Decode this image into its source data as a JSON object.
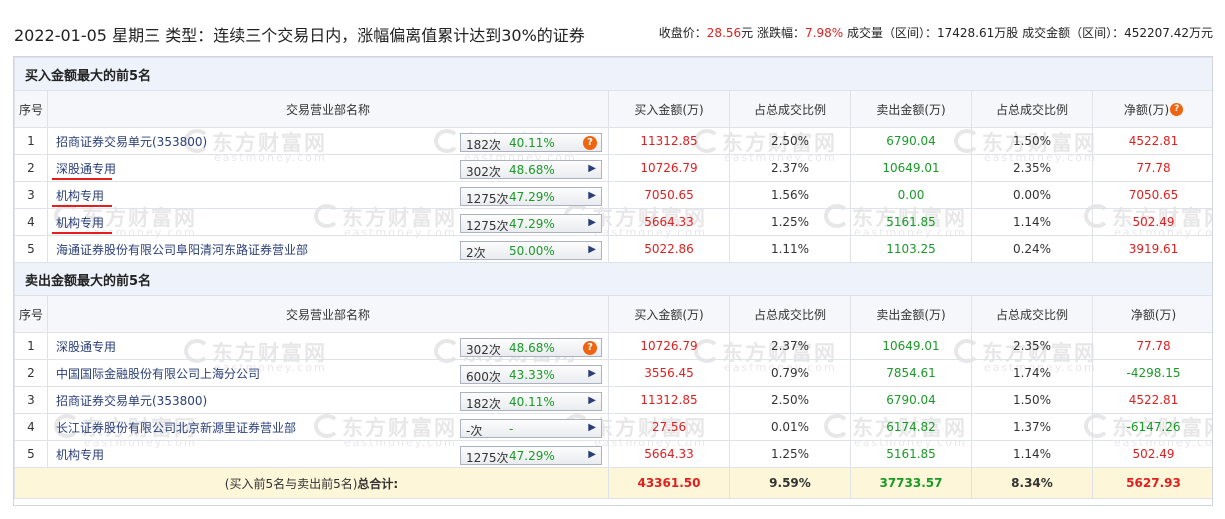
{
  "header": {
    "date": "2022-01-05",
    "weekday": "星期三",
    "type_label": "类型：",
    "type_text": "连续三个交易日内，涨幅偏离值累计达到30%的证券",
    "close_label": "收盘价：",
    "close_value": "28.56",
    "close_unit": "元",
    "change_label": "涨跌幅：",
    "change_value": "7.98%",
    "volume_label": "成交量（区间）：",
    "volume_value": "17428.61万股",
    "amount_label": "成交金额（区间）：",
    "amount_value": "452207.42万元"
  },
  "columns": {
    "seq": "序号",
    "name": "交易营业部名称",
    "buy": "买入金额(万)",
    "buy_ratio": "占总成交比例",
    "sell": "卖出金额(万)",
    "sell_ratio": "占总成交比例",
    "net": "净额(万)"
  },
  "watermark": {
    "cn": "东方财富网",
    "en": "eastmoney.com"
  },
  "buy_section": {
    "title": "买入金额最大的前5名",
    "rows": [
      {
        "seq": "1",
        "name": "招商证券交易单元(353800)",
        "count": "182次",
        "pct": "40.11%",
        "buy": "11312.85",
        "buy_ratio": "2.50%",
        "sell": "6790.04",
        "sell_ratio": "1.50%",
        "net": "4522.81"
      },
      {
        "seq": "2",
        "name": "深股通专用",
        "count": "302次",
        "pct": "48.68%",
        "buy": "10726.79",
        "buy_ratio": "2.37%",
        "sell": "10649.01",
        "sell_ratio": "2.35%",
        "net": "77.78"
      },
      {
        "seq": "3",
        "name": "机构专用",
        "count": "1275次",
        "pct": "47.29%",
        "buy": "7050.65",
        "buy_ratio": "1.56%",
        "sell": "0.00",
        "sell_ratio": "0.00%",
        "net": "7050.65"
      },
      {
        "seq": "4",
        "name": "机构专用",
        "count": "1275次",
        "pct": "47.29%",
        "buy": "5664.33",
        "buy_ratio": "1.25%",
        "sell": "5161.85",
        "sell_ratio": "1.14%",
        "net": "502.49"
      },
      {
        "seq": "5",
        "name": "海通证券股份有限公司阜阳清河东路证券营业部",
        "count": "2次",
        "pct": "50.00%",
        "buy": "5022.86",
        "buy_ratio": "1.11%",
        "sell": "1103.25",
        "sell_ratio": "0.24%",
        "net": "3919.61"
      }
    ]
  },
  "sell_section": {
    "title": "卖出金额最大的前5名",
    "rows": [
      {
        "seq": "1",
        "name": "深股通专用",
        "count": "302次",
        "pct": "48.68%",
        "buy": "10726.79",
        "buy_ratio": "2.37%",
        "sell": "10649.01",
        "sell_ratio": "2.35%",
        "net": "77.78"
      },
      {
        "seq": "2",
        "name": "中国国际金融股份有限公司上海分公司",
        "count": "600次",
        "pct": "43.33%",
        "buy": "3556.45",
        "buy_ratio": "0.79%",
        "sell": "7854.61",
        "sell_ratio": "1.74%",
        "net": "-4298.15"
      },
      {
        "seq": "3",
        "name": "招商证券交易单元(353800)",
        "count": "182次",
        "pct": "40.11%",
        "buy": "11312.85",
        "buy_ratio": "2.50%",
        "sell": "6790.04",
        "sell_ratio": "1.50%",
        "net": "4522.81"
      },
      {
        "seq": "4",
        "name": "长江证券股份有限公司北京新源里证券营业部",
        "count": "-次",
        "pct": "-",
        "buy": "27.56",
        "buy_ratio": "0.01%",
        "sell": "6174.82",
        "sell_ratio": "1.37%",
        "net": "-6147.26"
      },
      {
        "seq": "5",
        "name": "机构专用",
        "count": "1275次",
        "pct": "47.29%",
        "buy": "5664.33",
        "buy_ratio": "1.25%",
        "sell": "5161.85",
        "sell_ratio": "1.14%",
        "net": "502.49"
      }
    ]
  },
  "total": {
    "label_prefix": "(买入前5名与卖出前5名)",
    "label_bold": "总合计:",
    "buy": "43361.50",
    "buy_ratio": "9.59%",
    "sell": "37733.57",
    "sell_ratio": "8.34%",
    "net": "5627.93"
  },
  "colors": {
    "up": "#e02020",
    "down": "#1a9a28",
    "link": "#2a3f7a",
    "section_bg": "#eef3fb",
    "total_bg": "#fdf6d8",
    "help_icon": "#f0640f"
  }
}
